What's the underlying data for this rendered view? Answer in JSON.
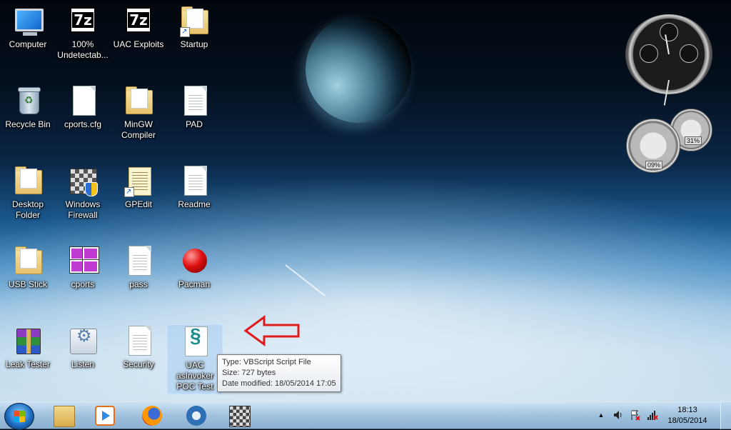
{
  "desktop": {
    "icons": [
      {
        "label": "Computer"
      },
      {
        "label": "100% Undetectab..."
      },
      {
        "label": "UAC Exploits"
      },
      {
        "label": "Startup"
      },
      {
        "label": "Recycle Bin"
      },
      {
        "label": "cports.cfg"
      },
      {
        "label": "MinGW Compiler"
      },
      {
        "label": "PAD"
      },
      {
        "label": "Desktop Folder"
      },
      {
        "label": "Windows Firewall"
      },
      {
        "label": "GPEdit"
      },
      {
        "label": "Readme"
      },
      {
        "label": "USB Stick"
      },
      {
        "label": "cports"
      },
      {
        "label": "pass"
      },
      {
        "label": "Pacman"
      },
      {
        "label": "Leak Tester"
      },
      {
        "label": "Listen"
      },
      {
        "label": "Security"
      },
      {
        "label": "UAC asInvoker POC Test"
      }
    ]
  },
  "tooltip": {
    "type": "Type: VBScript Script File",
    "size": "Size: 727 bytes",
    "modified": "Date modified: 18/05/2014 17:05"
  },
  "gadgets": {
    "cpu_percent": "09%",
    "ram_percent": "31%"
  },
  "taskbar": {
    "pinned": [
      "windows-explorer-icon",
      "media-player-icon",
      "firefox-icon",
      "thunderbird-icon",
      "windows-firewall-icon"
    ],
    "tray_caret": "▲",
    "clock_time": "18:13",
    "clock_date": "18/05/2014"
  },
  "colors": {
    "arrow": "#e01b1b",
    "tooltip_border": "#767676"
  }
}
